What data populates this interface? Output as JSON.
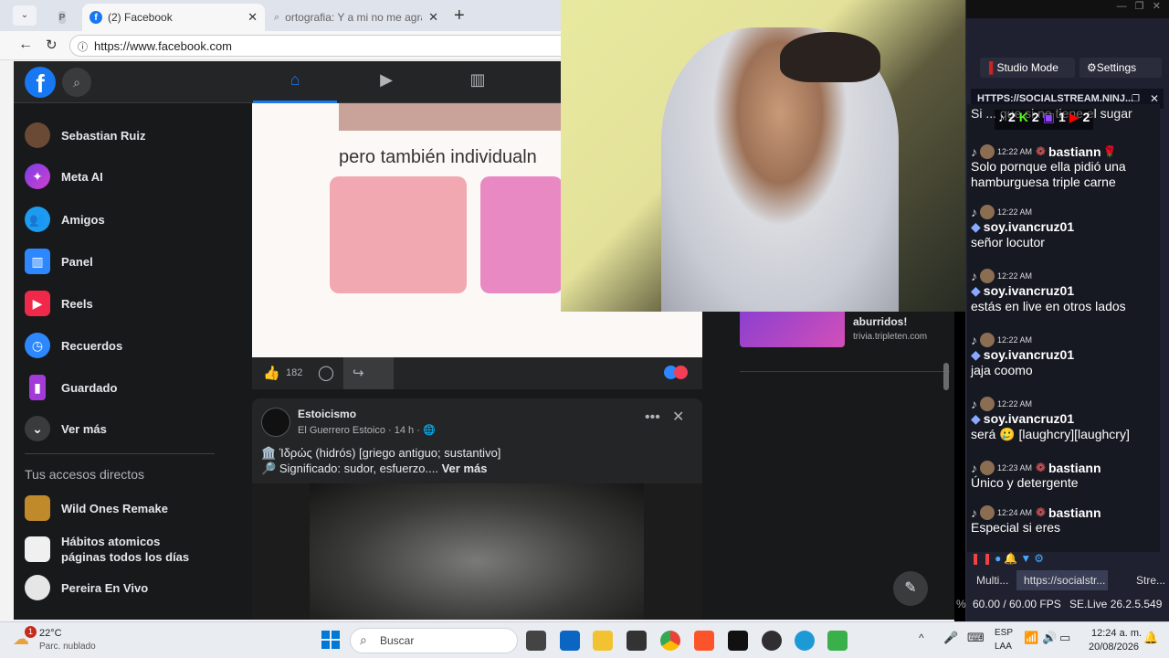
{
  "browser": {
    "tabs": [
      {
        "label": "P",
        "title": ""
      },
      {
        "label": "(2) Facebook"
      },
      {
        "label": "ortografia: Y a mi no me agradaria"
      }
    ],
    "url": "https://www.facebook.com"
  },
  "facebook": {
    "sidebar": [
      {
        "label": "Sebastian Ruiz",
        "icon": "avatar-icon"
      },
      {
        "label": "Meta AI",
        "icon": "meta-ai-icon"
      },
      {
        "label": "Amigos",
        "icon": "friends-icon"
      },
      {
        "label": "Panel",
        "icon": "panel-icon"
      },
      {
        "label": "Reels",
        "icon": "reels-icon"
      },
      {
        "label": "Recuerdos",
        "icon": "memories-icon"
      },
      {
        "label": "Guardado",
        "icon": "saved-icon"
      },
      {
        "label": "Ver más",
        "icon": "chevron-down-icon"
      }
    ],
    "shortcuts_title": "Tus accesos directos",
    "shortcuts": [
      "Wild Ones Remake",
      "Hábitos atomicos páginas todos los días",
      "Pereira En Vivo"
    ],
    "post1": {
      "image_text": "pero también individualn",
      "likes": "182"
    },
    "post2": {
      "page": "Estoicismo",
      "author": "El Guerrero Estoico",
      "time": "14 h",
      "line1": "Ἱδρώς (hidrós) [griego antiguo; sustantivo]",
      "line2": "Significado: sudor, esfuerzo....",
      "more": "Ver más"
    },
    "ad": {
      "title": "aburridos!",
      "domain": "trivia.tripleten.com"
    }
  },
  "obs": {
    "studio_mode": "Studio Mode",
    "settings": "Settings",
    "header": "HTTPS://SOCIALSTREAM.NINJ...",
    "counters": [
      "2",
      "2",
      "1",
      "2"
    ],
    "top_partial": "Si ... que si no tiene el sugar",
    "chat": [
      {
        "time": "12:22 AM",
        "name": "bastiann",
        "msg": "Solo pornque ella pidió una hamburguesa triple carne"
      },
      {
        "time": "12:22 AM",
        "name": "soy.ivancruz01",
        "msg": "señor locutor"
      },
      {
        "time": "12:22 AM",
        "name": "soy.ivancruz01",
        "msg": "estás en live en otros lados"
      },
      {
        "time": "12:22 AM",
        "name": "soy.ivancruz01",
        "msg": "jaja coomo"
      },
      {
        "time": "12:22 AM",
        "name": "soy.ivancruz01",
        "msg": "será 🥲 [laughcry][laughcry]"
      },
      {
        "time": "12:23 AM",
        "name": "bastiann",
        "msg": "Único y detergente"
      },
      {
        "time": "12:24 AM",
        "name": "bastiann",
        "msg": "Especial si eres"
      }
    ],
    "bottom_tabs": [
      "Multi...",
      "https://socialstr...",
      "Stre..."
    ],
    "status": "60.00 / 60.00 FPS",
    "version": "SE.Live 26.2.5.549",
    "status_prefix": "%"
  },
  "taskbar": {
    "temp": "22°C",
    "weather": "Parc. nublado",
    "search": "Buscar",
    "lang1": "ESP",
    "lang2": "LAA",
    "time": "12:24 a. m.",
    "date": "20/08/2026"
  }
}
